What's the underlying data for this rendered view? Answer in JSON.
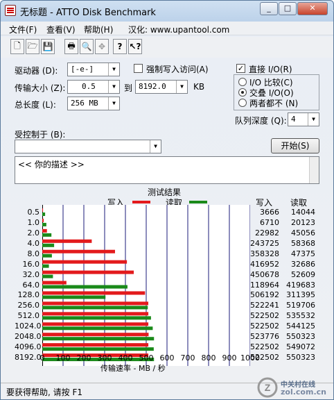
{
  "window": {
    "title": "无标题 - ATTO Disk Benchmark",
    "minimize_glyph": "_",
    "maximize_glyph": "□",
    "close_glyph": "✕"
  },
  "menu": {
    "file": "文件(F)",
    "view": "查看(V)",
    "help": "帮助(H)",
    "localized": "汉化: www.upantool.com"
  },
  "toolbar": {
    "icons": [
      "new-icon",
      "open-icon",
      "save-icon",
      "print-icon",
      "print-preview-icon",
      "move-icon",
      "help-icon",
      "whats-this-icon"
    ],
    "glyphs": [
      "🗋",
      "🗁",
      "💾",
      "🖶",
      "🔍",
      "✥",
      "?",
      "↖?"
    ]
  },
  "form": {
    "drive_label": "驱动器 (D):",
    "drive_value": "[-e-]",
    "force_write_label": "强制写入访问(A)",
    "direct_io_label": "直接 I/O(R)",
    "transfer_size_label": "传输大小 (Z):",
    "transfer_from": "0.5",
    "to_label": "到",
    "transfer_to": "8192.0",
    "kb_label": "KB",
    "total_length_label": "总长度 (L):",
    "total_length_value": "256 MB",
    "io_compare_label": "I/O 比较(C)",
    "overlapped_io_label": "交叠 I/O(O)",
    "neither_label": "两者都不 (N)",
    "queue_depth_label": "队列深度 (Q):",
    "queue_depth_value": "4",
    "controlled_by_label": "受控制于 (B):",
    "controlled_by_value": "",
    "start_button": "开始(S)",
    "description": "<<   你的描述   >>"
  },
  "chart_data": {
    "type": "bar",
    "title": "测试结果",
    "legend": {
      "write": "写入",
      "read": "读取",
      "placement": "top"
    },
    "colors": {
      "write": "#e31a1c",
      "read": "#1a8a1a"
    },
    "categories": [
      "0.5",
      "1.0",
      "2.0",
      "4.0",
      "8.0",
      "16.0",
      "32.0",
      "64.0",
      "128.0",
      "256.0",
      "512.0",
      "1024.0",
      "2048.0",
      "4096.0",
      "8192.0"
    ],
    "series": [
      {
        "name": "写入",
        "values": [
          3666,
          6710,
          22982,
          243725,
          358328,
          416952,
          450678,
          118964,
          506192,
          522241,
          522502,
          522502,
          523776,
          522502,
          522502
        ]
      },
      {
        "name": "读取",
        "values": [
          14044,
          20123,
          45056,
          58368,
          47375,
          32686,
          52609,
          419683,
          311395,
          519706,
          535532,
          544125,
          550323,
          549072,
          550323
        ]
      }
    ],
    "xlabel": "传输速率 - MB / 秒",
    "xticks": [
      "0",
      "100",
      "200",
      "300",
      "400",
      "500",
      "600",
      "700",
      "800",
      "900",
      "1000"
    ],
    "xlim": [
      0,
      1000
    ],
    "col_write": "写入",
    "col_read": "读取"
  },
  "status": {
    "text": "要获得帮助, 请按 F1"
  },
  "watermark": {
    "line1": "中关村在线",
    "line2": "zol.com.cn"
  }
}
